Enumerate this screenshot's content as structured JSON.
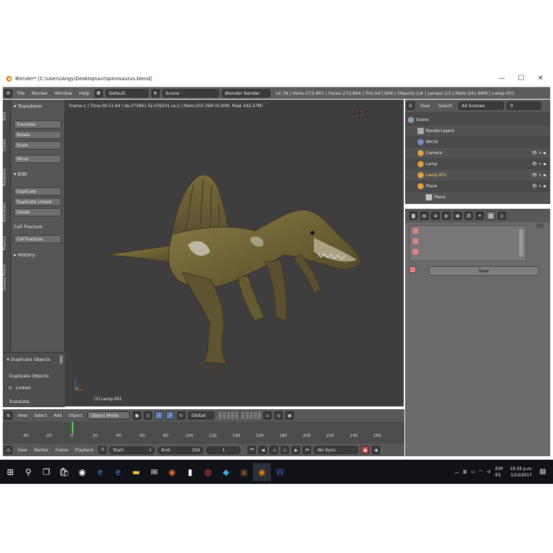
{
  "window": {
    "title": "Blender* [C:\\Users\\Angy\\Desktop\\avi\\spinosaurus.blend]",
    "minimize": "—",
    "maximize": "☐",
    "close": "✕"
  },
  "header": {
    "menus": [
      "File",
      "Render",
      "Window",
      "Help"
    ],
    "layout_value": "Default",
    "scene_value": "Scene",
    "engine_value": "Blender Render",
    "stats": "v2.78 | Verts:273,961 | Faces:273,864 | Tris:547,608 | Objects:1/4 | Lamps:1/2 | Mem:241.6KM | Lamp.001"
  },
  "vertical_tabs": [
    "Tools",
    "Create",
    "Relations",
    "Animation",
    "Physics",
    "Grease Pencil"
  ],
  "toolshelf": {
    "transform_header": "Transform",
    "transform_buttons": [
      "Translate",
      "Rotate",
      "Scale"
    ],
    "mirror": "Mirror",
    "edit_header": "Edit",
    "edit_buttons": [
      "Duplicate",
      "Duplicate Linked",
      "Delete"
    ],
    "cell_fracture_label": "Cell Fracture",
    "cell_fracture_button": "Cell Fracture",
    "history_header": "History"
  },
  "redo_panel": {
    "header": "Duplicate Objects",
    "op_label": "Duplicate Objects",
    "linked_label": "Linked",
    "translate_label": "Translate"
  },
  "viewport": {
    "info": "Frame:1 | Time:00:11.64 | Ve:273961 Fa:476231 La:2 | Mem:250.76M (0.00M, Peak 342.27M)",
    "object_label": "(1) Lamp.001",
    "menus": [
      "View",
      "Select",
      "Add",
      "Object"
    ],
    "mode": "Object Mode",
    "orientation": "Global"
  },
  "timeline": {
    "ticks": [
      "-40",
      "-20",
      "0",
      "20",
      "40",
      "60",
      "80",
      "100",
      "120",
      "140",
      "160",
      "180",
      "200",
      "220",
      "240",
      "260"
    ],
    "menus": [
      "View",
      "Marker",
      "Frame",
      "Playback"
    ],
    "start_label": "Start:",
    "start_value": "1",
    "end_label": "End:",
    "end_value": "250",
    "current_frame": "1",
    "sync": "No Sync"
  },
  "outliner": {
    "menus": [
      "View",
      "Search"
    ],
    "filter": "All Scenes",
    "items": [
      {
        "label": "Scene",
        "indent": 0
      },
      {
        "label": "RenderLayers",
        "indent": 1
      },
      {
        "label": "World",
        "indent": 1
      },
      {
        "label": "Camera",
        "indent": 1
      },
      {
        "label": "Lamp",
        "indent": 1
      },
      {
        "label": "Lamp.001",
        "indent": 1
      },
      {
        "label": "Plane",
        "indent": 1
      },
      {
        "label": "Plane",
        "indent": 2
      }
    ]
  },
  "properties": {
    "new_button": "New"
  },
  "taskbar": {
    "lang": "ESP",
    "lang2": "ES",
    "time": "10:35 p.m.",
    "date": "1/12/2017"
  },
  "colors": {
    "ui_dark": "#3e3e3e",
    "ui_mid": "#585858",
    "taskbar": "#101218",
    "highlight_orange": "#e0a040"
  }
}
